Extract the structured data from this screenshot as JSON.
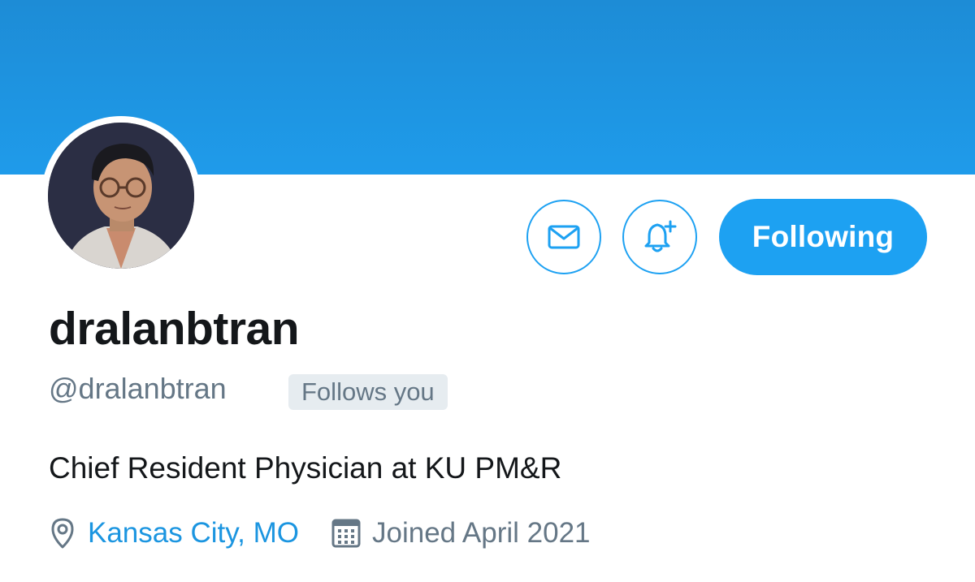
{
  "colors": {
    "accent": "#1da1f2",
    "banner": "#1f9bea",
    "link": "#1b95e0",
    "secondary_text": "#657786",
    "primary_text": "#14171a",
    "badge_bg": "#e6ecf0"
  },
  "profile": {
    "display_name": "dralanbtran",
    "handle": "@dralanbtran",
    "follows_you_badge": "Follows you",
    "bio": "Chief Resident Physician at KU PM&R",
    "location": "Kansas City, MO",
    "joined": "Joined April 2021"
  },
  "actions": {
    "message_icon": "envelope-icon",
    "notify_icon": "bell-plus-icon",
    "following_label": "Following"
  },
  "icons": {
    "location": "map-pin-icon",
    "joined": "calendar-icon"
  }
}
